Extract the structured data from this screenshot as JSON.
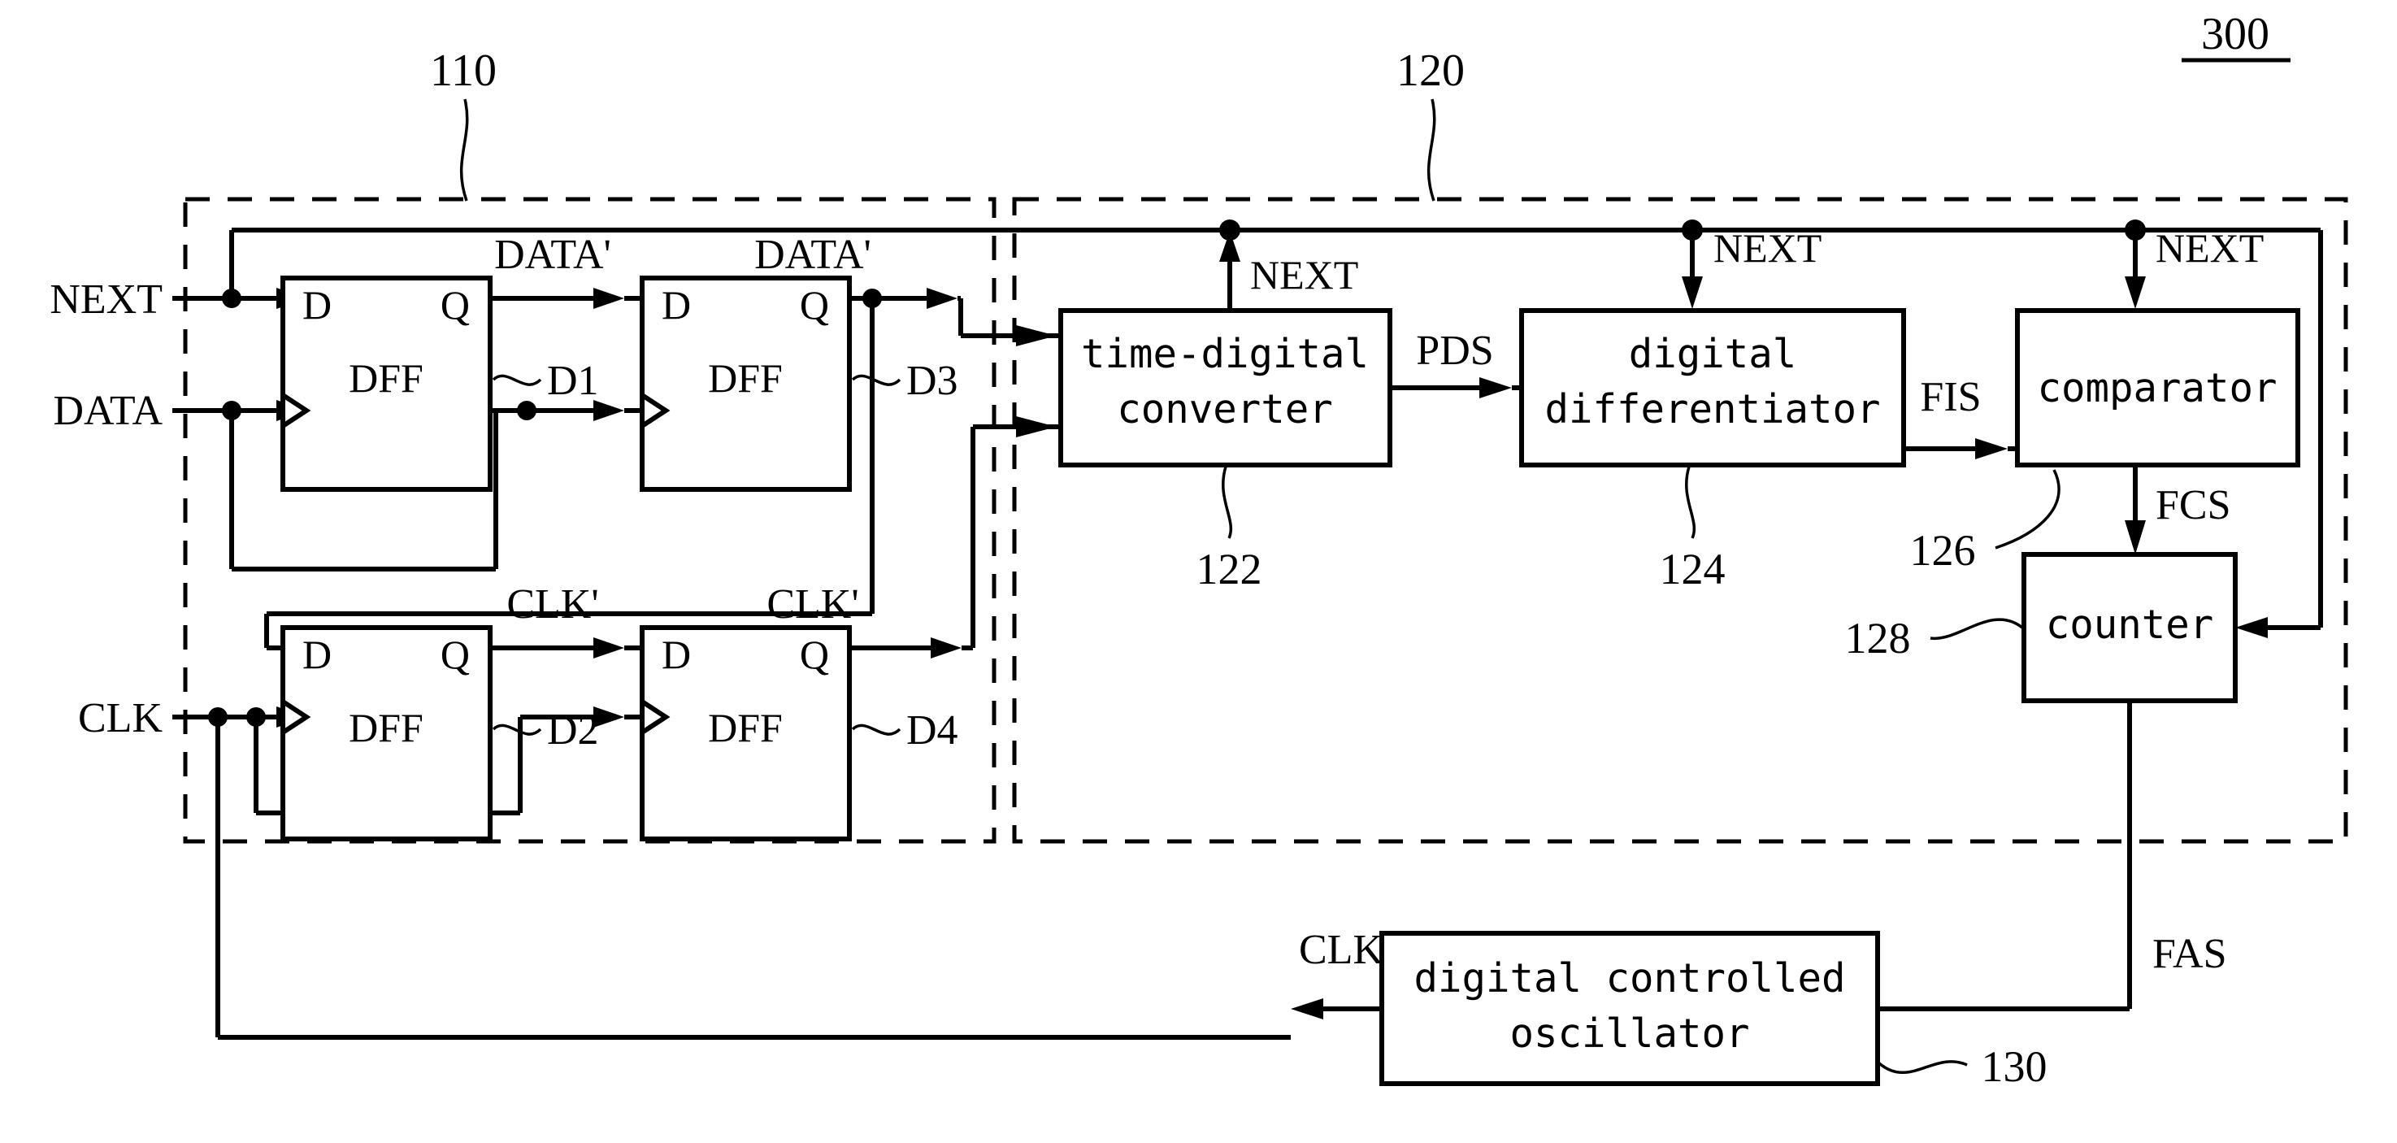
{
  "figure": {
    "number": "300",
    "type": "block-diagram"
  },
  "reference_labels": {
    "block_110": "110",
    "block_120": "120",
    "block_122": "122",
    "block_124": "124",
    "block_126": "126",
    "block_128": "128",
    "block_130": "130",
    "dff1": "D1",
    "dff2": "D2",
    "dff3": "D3",
    "dff4": "D4"
  },
  "inputs": {
    "next": "NEXT",
    "data": "DATA",
    "clk": "CLK"
  },
  "dff_blocks": [
    {
      "id": "D1",
      "title": "DFF",
      "d_label": "D",
      "q_label": "Q",
      "out_signal": "DATA'"
    },
    {
      "id": "D3",
      "title": "DFF",
      "d_label": "D",
      "q_label": "Q",
      "out_signal": "DATA'"
    },
    {
      "id": "D2",
      "title": "DFF",
      "d_label": "D",
      "q_label": "Q",
      "out_signal": "CLK'"
    },
    {
      "id": "D4",
      "title": "DFF",
      "d_label": "D",
      "q_label": "Q",
      "out_signal": "CLK'"
    }
  ],
  "function_blocks": [
    {
      "id": "122",
      "line1": "time-digital",
      "line2": "converter",
      "ref": "122"
    },
    {
      "id": "124",
      "line1": "digital",
      "line2": "differentiator",
      "ref": "124"
    },
    {
      "id": "126",
      "line1": "comparator",
      "line2": "",
      "ref": "126"
    },
    {
      "id": "128",
      "line1": "counter",
      "line2": "",
      "ref": "128"
    },
    {
      "id": "130",
      "line1": "digital controlled",
      "line2": "oscillator",
      "ref": "130"
    }
  ],
  "signals": {
    "pds": "PDS",
    "fis": "FIS",
    "fcs": "FCS",
    "fas": "FAS",
    "clk_out": "CLK",
    "next_tdc": "NEXT",
    "next_diff": "NEXT",
    "next_comp": "NEXT",
    "data_prime_1": "DATA'",
    "data_prime_2": "DATA'",
    "clk_prime_1": "CLK'",
    "clk_prime_2": "CLK'"
  },
  "colors": {
    "line": "#000000",
    "background": "#ffffff"
  }
}
